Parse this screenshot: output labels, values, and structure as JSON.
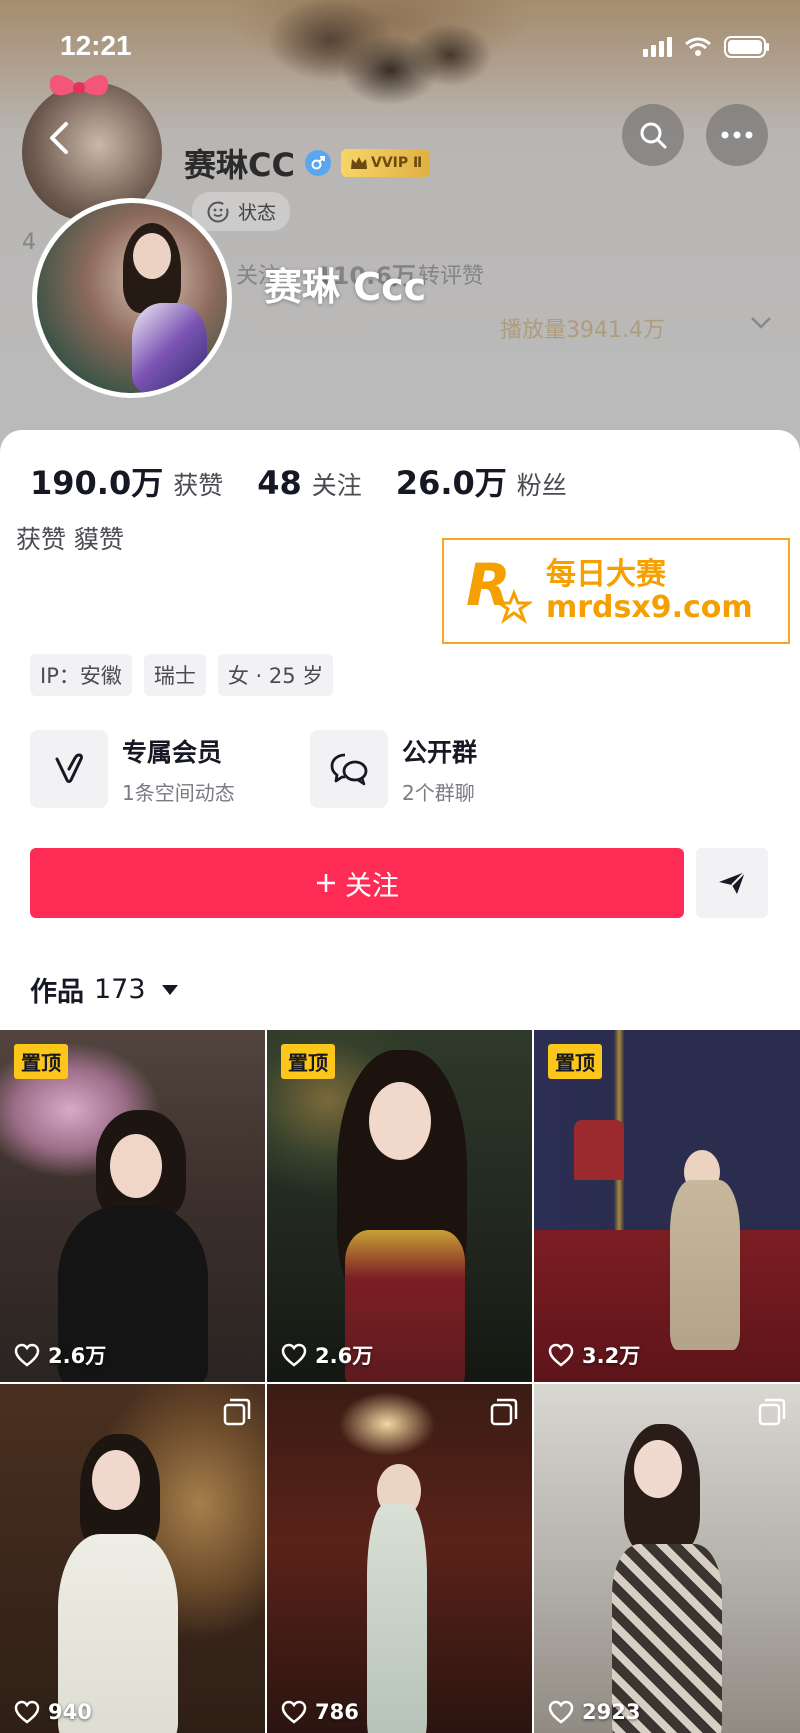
{
  "status_bar": {
    "time": "12:21"
  },
  "profile": {
    "name": "赛琳CC",
    "vip_label": "VVIP Ⅱ",
    "status_label": "状态",
    "overlay_name": "赛琳 Ccc",
    "ghost_following": "关注",
    "ghost_likes": "110.6万",
    "ghost_likes_label": "转评赞",
    "ghost_plays": "播放量3941.4万"
  },
  "stats": [
    {
      "value": "190.0万",
      "label": "获赞"
    },
    {
      "value": "48",
      "label": "关注"
    },
    {
      "value": "26.0万",
      "label": "粉丝"
    }
  ],
  "bio": "获赞 貘赞",
  "ad": {
    "title": "每日大赛",
    "url": "mrdsx9.com",
    "logo_letter": "R",
    "logo_small": "每日大赛"
  },
  "tags": [
    "IP：安徽",
    "瑞士",
    "女 · 25 岁"
  ],
  "features": [
    {
      "title": "专属会员",
      "subtitle": "1条空间动态"
    },
    {
      "title": "公开群",
      "subtitle": "2个群聊"
    }
  ],
  "follow_label": "关注",
  "works": {
    "label": "作品",
    "count": "173"
  },
  "pinned_label": "置顶",
  "videos": [
    {
      "likes": "2.6万",
      "pinned": true,
      "multi": false
    },
    {
      "likes": "2.6万",
      "pinned": true,
      "multi": false
    },
    {
      "likes": "3.2万",
      "pinned": true,
      "multi": false
    },
    {
      "likes": "940",
      "pinned": false,
      "multi": true
    },
    {
      "likes": "786",
      "pinned": false,
      "multi": true
    },
    {
      "likes": "2923",
      "pinned": false,
      "multi": true
    }
  ],
  "colors": {
    "accent": "#fe2c55",
    "pin": "#fcc61a",
    "vip": "#e0b043",
    "ad": "#f5a000"
  }
}
